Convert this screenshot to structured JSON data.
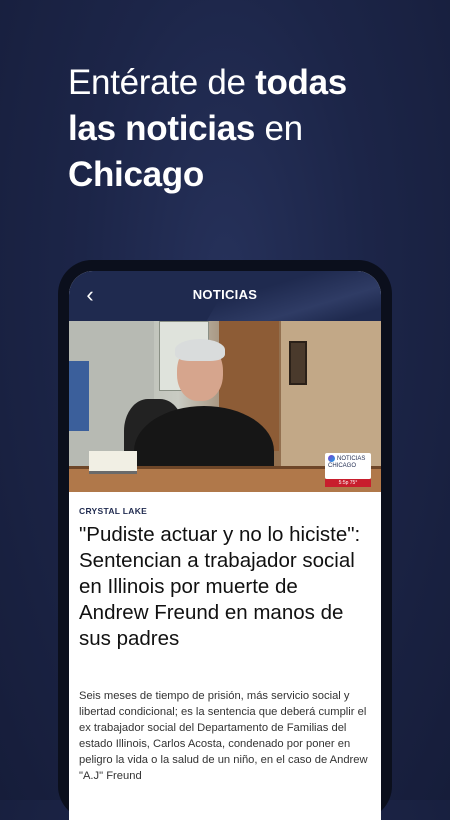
{
  "promo": {
    "line1_a": "Entérate de ",
    "line1_b": "todas",
    "line2_a": "las noticias",
    "line2_b": " en",
    "line3": "Chicago"
  },
  "appbar": {
    "title": "NOTICIAS",
    "back_icon": "chevron-left-icon"
  },
  "hero": {
    "logo_text": "NOTICIAS",
    "logo_sub": "CHICAGO",
    "logo_strip": "5:5p  75°"
  },
  "article": {
    "kicker": "CRYSTAL LAKE",
    "headline": "\"Pudiste actuar y no lo hiciste\": Sentencian a trabajador social en Illinois por muerte de Andrew Freund en manos de sus padres",
    "body": "Seis meses de tiempo de prisión, más servicio social y libertad condicional; es la sentencia que deberá cumplir el ex trabajador social del Departamento de Familias del estado Illinois, Carlos Acosta, condenado por poner en peligro la vida o la salud de un niño, en el caso de Andrew \"A.J\" Freund"
  },
  "colors": {
    "background": "#1c2548",
    "appbar": "#1f2a4f",
    "text_white": "#ffffff",
    "kicker": "#1f2a4f"
  }
}
